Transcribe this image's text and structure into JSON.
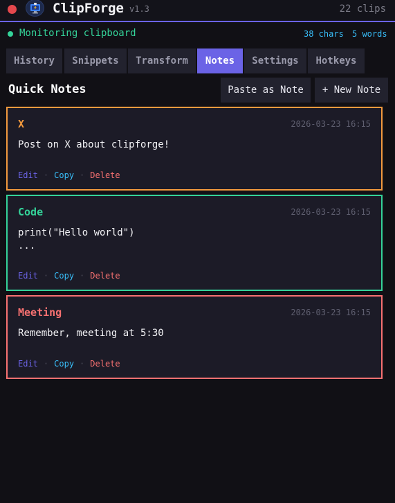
{
  "app": {
    "name": "ClipForge",
    "version": "v1.3",
    "clip_count": "22 clips",
    "logo_icon": "clipboard-monitor-icon",
    "close_icon": "close-dot-icon"
  },
  "status": {
    "text": "Monitoring clipboard",
    "chars": "38 chars",
    "words": "5 words"
  },
  "tabs": [
    {
      "label": "History"
    },
    {
      "label": "Snippets"
    },
    {
      "label": "Transform"
    },
    {
      "label": "Notes"
    },
    {
      "label": "Settings"
    },
    {
      "label": "Hotkeys"
    }
  ],
  "active_tab": "Notes",
  "notes_section": {
    "title": "Quick Notes",
    "paste_button": "Paste as Note",
    "new_button": "+ New Note"
  },
  "notes": [
    {
      "title": "X",
      "time": "2026-03-23 16:15",
      "body": "Post on X about clipforge!",
      "color": "#f39a3e",
      "edit": "Edit",
      "copy": "Copy",
      "delete": "Delete"
    },
    {
      "title": "Code",
      "time": "2026-03-23 16:15",
      "body": "print(\"Hello world\")\n...",
      "color": "#34d399",
      "edit": "Edit",
      "copy": "Copy",
      "delete": "Delete"
    },
    {
      "title": "Meeting",
      "time": "2026-03-23 16:15",
      "body": "Remember, meeting at 5:30",
      "color": "#f87171",
      "edit": "Edit",
      "copy": "Copy",
      "delete": "Delete"
    }
  ],
  "colors": {
    "accent": "#6b63e6",
    "success": "#34d399",
    "info": "#38bdf8",
    "danger": "#f87171"
  }
}
